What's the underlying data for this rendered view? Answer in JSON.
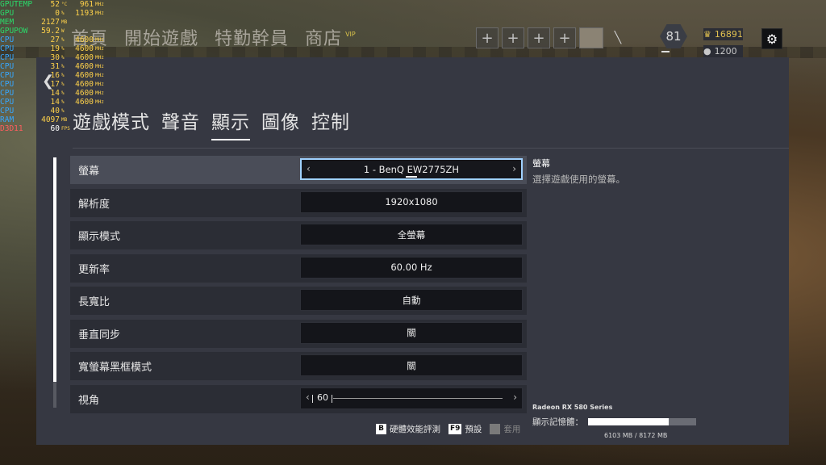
{
  "overlay": {
    "rows": [
      {
        "label": "GPUTEMP",
        "v1": "52",
        "u1": "°C",
        "v2": "961",
        "u2": "MHz",
        "cls": ""
      },
      {
        "label": "GPU",
        "v1": "0",
        "u1": "%",
        "v2": "1193",
        "u2": "MHz",
        "cls": ""
      },
      {
        "label": "MEM",
        "v1": "2127",
        "u1": "MB",
        "v2": "",
        "u2": "",
        "cls": ""
      },
      {
        "label": "GPUPOW",
        "v1": "59.2",
        "u1": "W",
        "v2": "",
        "u2": "",
        "cls": ""
      },
      {
        "label": "CPU",
        "v1": "27",
        "u1": "%",
        "v2": "4600",
        "u2": "MHz",
        "cls": "cpu"
      },
      {
        "label": "CPU",
        "v1": "19",
        "u1": "%",
        "v2": "4600",
        "u2": "MHz",
        "cls": "cpu"
      },
      {
        "label": "CPU",
        "v1": "30",
        "u1": "%",
        "v2": "4600",
        "u2": "MHz",
        "cls": "cpu"
      },
      {
        "label": "CPU",
        "v1": "31",
        "u1": "%",
        "v2": "4600",
        "u2": "MHz",
        "cls": "cpu"
      },
      {
        "label": "CPU",
        "v1": "16",
        "u1": "%",
        "v2": "4600",
        "u2": "MHz",
        "cls": "cpu"
      },
      {
        "label": "CPU",
        "v1": "17",
        "u1": "%",
        "v2": "4600",
        "u2": "MHz",
        "cls": "cpu"
      },
      {
        "label": "CPU",
        "v1": "14",
        "u1": "%",
        "v2": "4600",
        "u2": "MHz",
        "cls": "cpu"
      },
      {
        "label": "CPU",
        "v1": "14",
        "u1": "%",
        "v2": "4600",
        "u2": "MHz",
        "cls": "cpu"
      },
      {
        "label": "CPU",
        "v1": "40",
        "u1": "%",
        "v2": "",
        "u2": "",
        "cls": "cpu"
      },
      {
        "label": "RAM",
        "v1": "4097",
        "u1": "MB",
        "v2": "",
        "u2": "",
        "cls": "ram"
      },
      {
        "label": "D3D11",
        "v1": "60",
        "u1": "FPS",
        "v2": "",
        "u2": "",
        "cls": "d3d"
      }
    ]
  },
  "topnav": {
    "items": [
      "首頁",
      "開始遊戲",
      "特勤幹員",
      "商店"
    ],
    "shop_badge": "VIP"
  },
  "squad": {
    "slots": [
      "+",
      "+",
      "+",
      "+"
    ]
  },
  "player": {
    "level": "81",
    "renown": "16891",
    "credits": "1200"
  },
  "tabs": [
    "遊戲模式",
    "聲音",
    "顯示",
    "圖像",
    "控制"
  ],
  "active_tab": "顯示",
  "settings": [
    {
      "label": "螢幕",
      "value": "1 - BenQ EW2775ZH"
    },
    {
      "label": "解析度",
      "value": "1920x1080"
    },
    {
      "label": "顯示模式",
      "value": "全螢幕"
    },
    {
      "label": "更新率",
      "value": "60.00 Hz"
    },
    {
      "label": "長寬比",
      "value": "自動"
    },
    {
      "label": "垂直同步",
      "value": "關"
    },
    {
      "label": "寬螢幕黑框模式",
      "value": "關"
    },
    {
      "label": "視角",
      "value": "60"
    }
  ],
  "description": {
    "title": "螢幕",
    "text": "選擇遊戲使用的螢幕。"
  },
  "gpu": {
    "name": "Radeon RX 580 Series",
    "vram_label": "顯示記憶體：",
    "vram_used": 6103,
    "vram_total": 8172,
    "vram_text": "6103 MB / 8172 MB"
  },
  "footer": {
    "benchmark_key": "B",
    "benchmark_label": "硬體效能評測",
    "default_key": "F9",
    "default_label": "預設",
    "apply_label": "套用"
  },
  "colors": {
    "panel": "#363842",
    "row": "#2b2d35",
    "active_border": "#9fd1ff",
    "renown": "#e0c050"
  }
}
